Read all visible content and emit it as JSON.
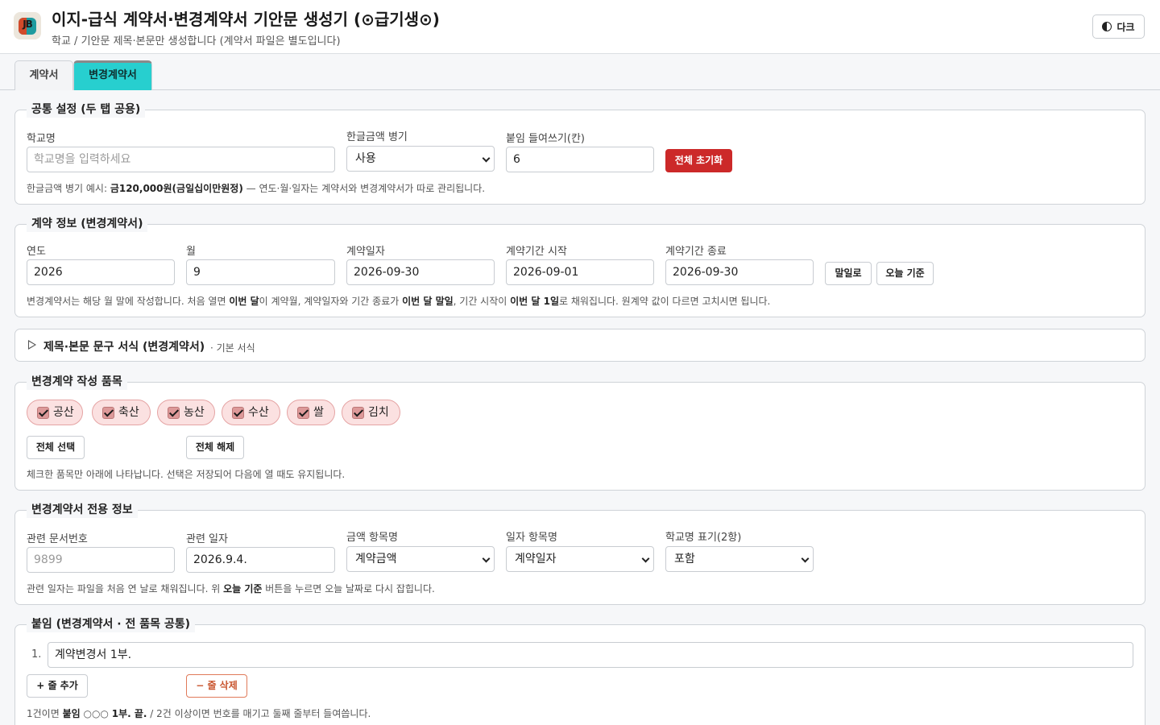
{
  "header": {
    "logo_text": "JB",
    "title": "이지-급식 계약서·변경계약서 기안문 생성기 (⊙급기생⊙)",
    "subtitle": "학교 / 기안문 제목·본문만 생성합니다 (계약서 파일은 별도입니다)",
    "dark_label": "다크"
  },
  "tabs": [
    {
      "label": "계약서",
      "active": false
    },
    {
      "label": "변경계약서",
      "active": true
    }
  ],
  "common": {
    "legend": "공통 설정 (두 탭 공용)",
    "school_label": "학교명",
    "school_placeholder": "학교명을 입력하세요",
    "school_value": "",
    "korean_amount_label": "한글금액 병기",
    "korean_amount_value": "사용",
    "indent_label": "붙임 들여쓰기(칸)",
    "indent_value": "6",
    "reset_label": "전체 초기화",
    "help_prefix": "한글금액 병기 예시: ",
    "help_example": "금120,000원(금일십이만원정)",
    "help_suffix": " — 연도·월·일자는 계약서와 변경계약서가 따로 관리됩니다."
  },
  "contract": {
    "legend": "계약 정보 (변경계약서)",
    "year_label": "연도",
    "year_value": "2026",
    "month_label": "월",
    "month_value": "9",
    "date_label": "계약일자",
    "date_value": "2026-09-30",
    "start_label": "계약기간 시작",
    "start_value": "2026-09-01",
    "end_label": "계약기간 종료",
    "end_value": "2026-09-30",
    "month_end_btn": "말일로",
    "today_btn": "오늘 기준",
    "help": [
      {
        "t": "변경계약서는 해당 월 말에 작성합니다. 처음 열면 ",
        "b": false
      },
      {
        "t": "이번 달",
        "b": true
      },
      {
        "t": "이 계약월, 계약일자와 기간 종료가 ",
        "b": false
      },
      {
        "t": "이번 달 말일",
        "b": true
      },
      {
        "t": ", 기간 시작이 ",
        "b": false
      },
      {
        "t": "이번 달 1일",
        "b": true
      },
      {
        "t": "로 채워집니다. 원계약 값이 다르면 고치시면 됩니다.",
        "b": false
      }
    ]
  },
  "template_section": {
    "title": "제목·본문 문구 서식 (변경계약서)",
    "sub": "· 기본 서식"
  },
  "items": {
    "legend": "변경계약 작성 품목",
    "chips": [
      {
        "label": "공산",
        "checked": true
      },
      {
        "label": "축산",
        "checked": true
      },
      {
        "label": "농산",
        "checked": true
      },
      {
        "label": "수산",
        "checked": true
      },
      {
        "label": "쌀",
        "checked": true
      },
      {
        "label": "김치",
        "checked": true
      }
    ],
    "select_all": "전체 선택",
    "clear_all": "전체 해제",
    "help": "체크한 품목만 아래에 나타납니다. 선택은 저장되어 다음에 열 때도 유지됩니다."
  },
  "change_info": {
    "legend": "변경계약서 전용 정보",
    "doc_no_label": "관련 문서번호",
    "doc_no_placeholder": "9899",
    "related_date_label": "관련 일자",
    "related_date_value": "2026.9.4.",
    "amount_name_label": "금액 항목명",
    "amount_name_value": "계약금액",
    "date_name_label": "일자 항목명",
    "date_name_value": "계약일자",
    "school_display_label": "학교명 표기(2항)",
    "school_display_value": "포함",
    "help": [
      {
        "t": "관련 일자는 파일을 처음 연 날로 채워집니다. 위 ",
        "b": false
      },
      {
        "t": "오늘 기준",
        "b": true
      },
      {
        "t": " 버튼을 누르면 오늘 날짜로 다시 잡힙니다.",
        "b": false
      }
    ]
  },
  "attach": {
    "legend": "붙임 (변경계약서 · 전 품목 공통)",
    "rows": [
      {
        "no": "1.",
        "value": "계약변경서 1부."
      }
    ],
    "add_label": "+ 줄 추가",
    "remove_label": "− 줄 삭제",
    "help": [
      {
        "t": "1건이면 ",
        "b": false
      },
      {
        "t": "붙임",
        "b": true
      },
      {
        "t": "  ○○○ ",
        "b": false
      },
      {
        "t": "1부.  끝.",
        "b": true
      },
      {
        "t": " / 2건 이상이면 번호를 매기고 둘째 줄부터 들여씁니다.",
        "b": false
      }
    ]
  }
}
